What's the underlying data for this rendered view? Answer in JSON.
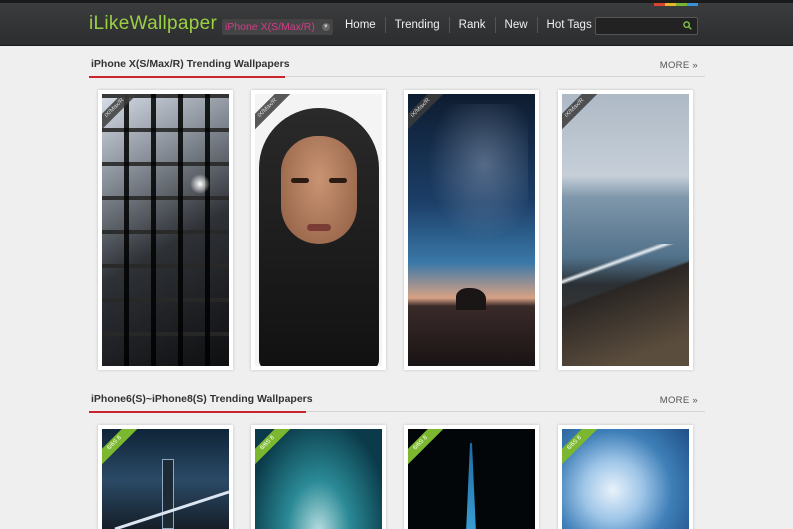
{
  "header": {
    "logo": "iLikeWallpaper",
    "device_selector": "iPhone X(S/Max/R)",
    "nav": [
      "Home",
      "Trending",
      "Rank",
      "New",
      "Hot Tags"
    ],
    "search_placeholder": "",
    "strip_colors": [
      "#d9432f",
      "#e7b42a",
      "#79b532",
      "#3b8fd4"
    ]
  },
  "sections": [
    {
      "title": "iPhone X(S/Max/R) Trending Wallpapers",
      "more": "MORE",
      "badge": "iX/Max/R",
      "items": [
        {
          "name": "black-metal-staircase"
        },
        {
          "name": "woman-in-black-hijab"
        },
        {
          "name": "milky-way-over-sea-rock"
        },
        {
          "name": "black-sand-beach-coast"
        }
      ]
    },
    {
      "title": "iPhone6(S)~iPhone8(S) Trending Wallpapers",
      "more": "MORE",
      "badge": "6/6S 8",
      "items": [
        {
          "name": "city-bridge-night"
        },
        {
          "name": "blue-water-splash"
        },
        {
          "name": "dubai-tower-night"
        },
        {
          "name": "blue-swirl-abstract"
        }
      ]
    }
  ],
  "accent_color": "#c9262c",
  "logo_color": "#9bd043"
}
